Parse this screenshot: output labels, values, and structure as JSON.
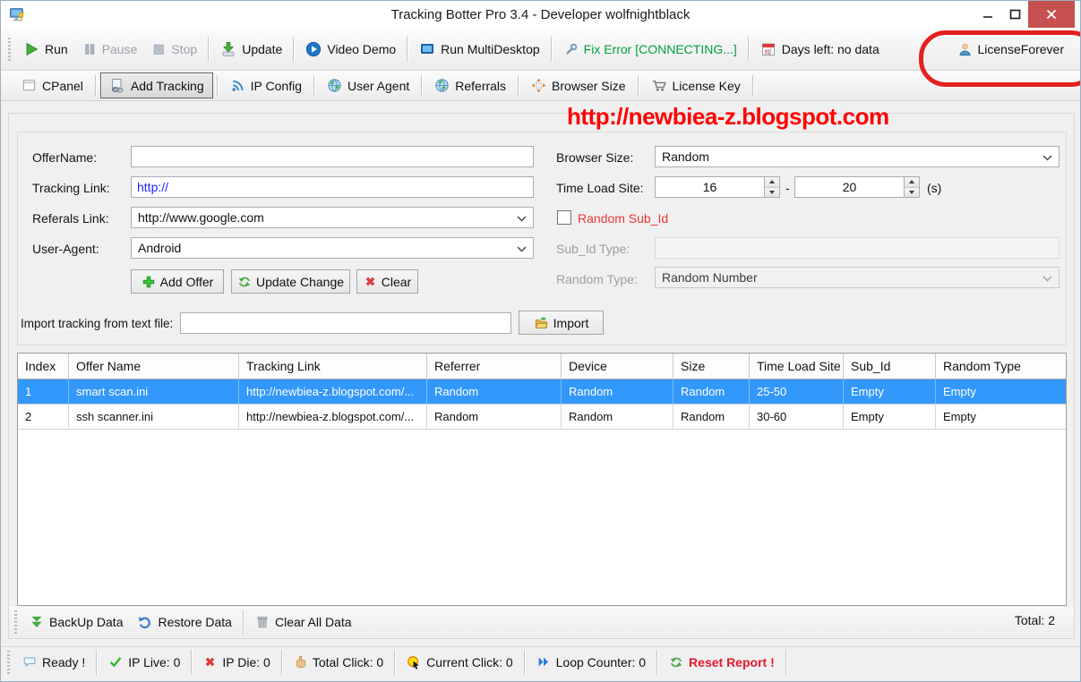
{
  "window": {
    "title": "Tracking Botter Pro 3.4 - Developer wolfnightblack"
  },
  "toolbar": {
    "run": "Run",
    "pause": "Pause",
    "stop": "Stop",
    "update": "Update",
    "video_demo": "Video Demo",
    "run_multidesktop": "Run MultiDesktop",
    "fix_error": "Fix Error [CONNECTING...]",
    "days_left": "Days left: no data",
    "license": "LicenseForever"
  },
  "tabs": {
    "cpanel": "CPanel",
    "add_tracking": "Add Tracking",
    "ip_config": "IP Config",
    "user_agent": "User Agent",
    "referrals": "Referrals",
    "browser_size": "Browser Size",
    "license_key": "License Key"
  },
  "watermark": "http://newbiea-z.blogspot.com",
  "form": {
    "offer_name_label": "OfferName:",
    "offer_name_value": "",
    "tracking_link_label": "Tracking Link:",
    "tracking_link_value": "http://",
    "referals_link_label": "Referals Link:",
    "referals_link_value": "http://www.google.com",
    "user_agent_label": "User-Agent:",
    "user_agent_value": "Android",
    "add_offer_button": "Add Offer",
    "update_change_button": "Update Change",
    "clear_button": "Clear",
    "browser_size_label": "Browser Size:",
    "browser_size_value": "Random",
    "time_load_site_label": "Time Load Site:",
    "time_min": "16",
    "time_dash": "-",
    "time_max": "20",
    "time_unit": "(s)",
    "random_sub_id_label": "Random Sub_Id",
    "random_sub_id_checked": false,
    "sub_id_type_label": "Sub_Id Type:",
    "sub_id_type_value": "",
    "random_type_label": "Random Type:",
    "random_type_value": "Random Number",
    "import_label": "Import tracking from text file:",
    "import_path_value": "",
    "import_button": "Import"
  },
  "grid": {
    "columns": [
      "Index",
      "Offer Name",
      "Tracking Link",
      "Referrer",
      "Device",
      "Size",
      "Time Load Site",
      "Sub_Id",
      "Random Type"
    ],
    "rows": [
      {
        "selected": true,
        "cells": [
          "1",
          "smart scan.ini",
          "http://newbiea-z.blogspot.com/...",
          "Random",
          "Random",
          "Random",
          "25-50",
          "Empty",
          "Empty"
        ]
      },
      {
        "selected": false,
        "cells": [
          "2",
          "ssh scanner.ini",
          "http://newbiea-z.blogspot.com/...",
          "Random",
          "Random",
          "Random",
          "30-60",
          "Empty",
          "Empty"
        ]
      }
    ]
  },
  "bottom_toolbar": {
    "backup": "BackUp Data",
    "restore": "Restore Data",
    "clear_all": "Clear All Data",
    "total": "Total: 2"
  },
  "statusbar": {
    "ready": "Ready !",
    "ip_live": "IP Live: 0",
    "ip_die": "IP Die: 0",
    "total_click": "Total Click: 0",
    "current_click": "Current Click: 0",
    "loop_counter": "Loop Counter: 0",
    "reset_report": "Reset Report !"
  },
  "icons": {
    "app": "monitor-bolt",
    "run": "green-play-triangle",
    "pause": "gray-pause-bars",
    "stop": "gray-stop-square",
    "update": "green-download-arrow",
    "video_demo": "blue-play-circle",
    "run_multidesktop": "blue-monitor",
    "fix_error": "wrench",
    "days_left": "calendar",
    "license": "person-bust",
    "cpanel": "panel-window",
    "add_tracking": "page-chain-link",
    "ip_config": "signal-arcs",
    "user_agent": "globe",
    "referrals": "globe",
    "browser_size": "orange-resize-arrows",
    "license_key": "shopping-cart",
    "add_offer": "green-plus",
    "update_change": "green-refresh-arrows",
    "clear": "red-x",
    "import": "open-folder",
    "backup": "green-double-down-chevron",
    "restore": "blue-undo-arrow",
    "clear_all": "trash-can",
    "ready": "speech-bubble",
    "ip_live": "green-check",
    "ip_die": "red-x",
    "total_click": "hand-pointer",
    "current_click": "yellow-click-cursor",
    "loop_counter": "blue-double-chevron",
    "reset_report": "green-refresh-arrows"
  },
  "colors": {
    "selected_row": "#3398fb",
    "watermark": "#ff0000",
    "fix_error_text": "#00a23c",
    "reset_report_text": "#e8192c",
    "random_sub_id_text": "#f03434",
    "tracking_link_text": "#1f1fff",
    "close_button": "#c75050",
    "annotation": "#e52020"
  }
}
